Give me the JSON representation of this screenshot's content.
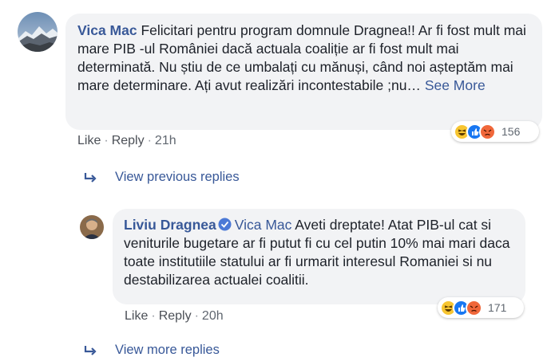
{
  "comment": {
    "author": "Vica Mac",
    "text": "Felicitari pentru program domnule Dragnea!! Ar fi fost mult mai mare PIB -ul României dacă actuala coaliție ar fi fost mult mai determinată. Nu știu de ce umbalați cu mănuși, când noi așteptăm mai mare determinare. Ați avut realizări incontestabile ;nu…",
    "see_more": "See More",
    "reaction_count": "156",
    "like_label": "Like",
    "reply_label": "Reply",
    "time": "21h"
  },
  "view_previous_replies": "View previous replies",
  "reply": {
    "author": "Liviu Dragnea",
    "mention": "Vica Mac",
    "text": "Aveti dreptate! Atat PIB-ul cat si veniturile bugetare ar fi putut fi cu cel putin 10% mai mari daca toate institutiile statului ar fi urmarit interesul Romaniei si nu destabilizarea actualei coalitii.",
    "reaction_count": "171",
    "like_label": "Like",
    "reply_label": "Reply",
    "time": "20h"
  },
  "view_more_replies": "View more replies",
  "colors": {
    "link": "#385898",
    "bubble": "#f2f3f5",
    "like_blue": "#1877f2",
    "haha_yellow": "#f7c531",
    "angry_orange": "#f0673a"
  },
  "icons": [
    "avatar-mountains",
    "verified-badge-icon",
    "haha-emoji-icon",
    "like-emoji-icon",
    "angry-emoji-icon",
    "reply-arrow-icon"
  ]
}
